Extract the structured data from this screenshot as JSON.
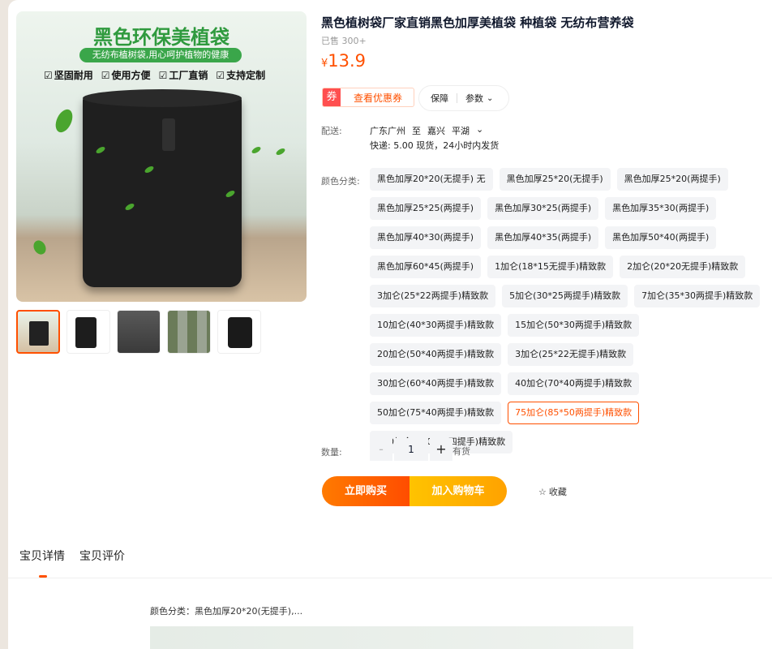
{
  "product": {
    "title": "黑色植树袋厂家直销黑色加厚美植袋 种植袋 无纺布营养袋",
    "sold": "已售 300+",
    "price_symbol": "¥",
    "price": "13.9"
  },
  "main_image": {
    "headline": "黑色环保美植袋",
    "subline": "无纺布植树袋,用心呵护植物的健康",
    "features": [
      "坚固耐用",
      "使用方便",
      "工厂直销",
      "支持定制"
    ]
  },
  "coupon": {
    "tag": "券",
    "label": "查看优惠券"
  },
  "guarantee": {
    "label1": "保障",
    "label2": "参数"
  },
  "shipping": {
    "label": "配送:",
    "from": "广东广州",
    "to_word": "至",
    "city": "嘉兴",
    "district": "平湖",
    "detail": "快递: 5.00  现货，24小时内发货"
  },
  "sku": {
    "label": "颜色分类:",
    "options": [
      "黑色加厚20*20(无提手) 无",
      "黑色加厚25*20(无提手)",
      "黑色加厚25*20(两提手)",
      "黑色加厚25*25(两提手)",
      "黑色加厚30*25(两提手)",
      "黑色加厚35*30(两提手)",
      "黑色加厚40*30(两提手)",
      "黑色加厚40*35(两提手)",
      "黑色加厚50*40(两提手)",
      "黑色加厚60*45(两提手)",
      "1加仑(18*15无提手)精致款",
      "2加仑(20*20无提手)精致款",
      "3加仑(25*22两提手)精致款",
      "5加仑(30*25两提手)精致款",
      "7加仑(35*30两提手)精致款",
      "10加仑(40*30两提手)精致款",
      "15加仑(50*30两提手)精致款",
      "20加仑(50*40两提手)精致款",
      "3加仑(25*22无提手)精致款",
      "30加仑(60*40两提手)精致款",
      "40加仑(70*40两提手)精致款",
      "50加仑(75*40两提手)精致款",
      "75加仑(85*50两提手)精致款",
      "100加仑(100*50四提手)精致款"
    ],
    "selected": "75加仑(85*50两提手)精致款"
  },
  "quantity": {
    "label": "数量:",
    "value": "1",
    "minus": "-",
    "plus": "+",
    "stock": "有货"
  },
  "actions": {
    "buy": "立即购买",
    "cart": "加入购物车",
    "favorite": "收藏"
  },
  "tabs": [
    "宝贝详情",
    "宝贝评价"
  ],
  "detail": {
    "color_line": "颜色分类：黑色加厚20*20(无提手),..."
  },
  "colors": {
    "accent": "#ff5000",
    "buy_start": "#ff7a00",
    "cart_start": "#ffc300"
  }
}
